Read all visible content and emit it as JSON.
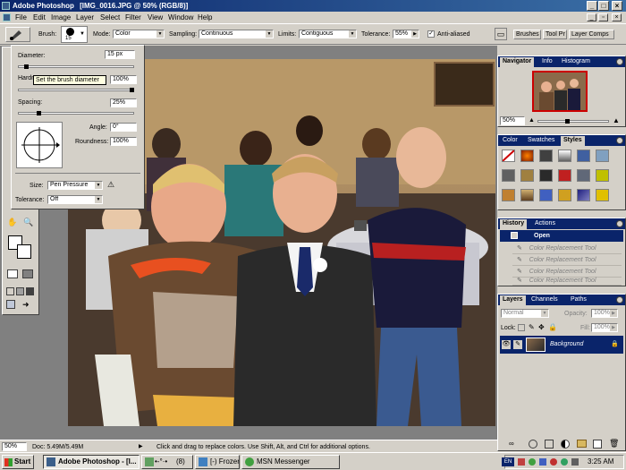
{
  "window": {
    "app_title": "Adobe Photoshop",
    "doc_title": "[IMG_0016.JPG @ 50% (RGB/8)]"
  },
  "menubar": [
    "File",
    "Edit",
    "Image",
    "Layer",
    "Select",
    "Filter",
    "View",
    "Window",
    "Help"
  ],
  "options": {
    "brush_label": "Brush:",
    "brush_size": "15",
    "mode_label": "Mode:",
    "mode_value": "Color",
    "sampling_label": "Sampling:",
    "sampling_value": "Continuous",
    "limits_label": "Limits:",
    "limits_value": "Contiguous",
    "tolerance_label": "Tolerance:",
    "tolerance_value": "55%",
    "antialiased_label": "Anti-aliased",
    "palette_tabs": [
      "Brushes",
      "Tool Pr",
      "Layer Comps"
    ]
  },
  "brush_popup": {
    "diameter_label": "Diameter:",
    "diameter_value": "15 px",
    "hardness_label": "Hardness:",
    "hardness_value": "100%",
    "spacing_label": "Spacing:",
    "spacing_value": "25%",
    "angle_label": "Angle:",
    "angle_value": "0°",
    "roundness_label": "Roundness:",
    "roundness_value": "100%",
    "size_label": "Size:",
    "size_value": "Pen Pressure",
    "tolerance_label": "Tolerance:",
    "tolerance_value": "Off",
    "tooltip": "Set the brush diameter"
  },
  "navigator": {
    "tabs": [
      "Navigator",
      "Info",
      "Histogram"
    ],
    "zoom": "50%"
  },
  "styles": {
    "tabs": [
      "Color",
      "Swatches",
      "Styles"
    ]
  },
  "history": {
    "tabs": [
      "History",
      "Actions"
    ],
    "items": [
      "Open",
      "Color Replacement Tool",
      "Color Replacement Tool",
      "Color Replacement Tool",
      "Color Replacement Tool"
    ]
  },
  "layers": {
    "tabs": [
      "Layers",
      "Channels",
      "Paths"
    ],
    "blend": "Normal",
    "opacity_label": "Opacity:",
    "opacity": "100%",
    "lock_label": "Lock:",
    "fill_label": "Fill:",
    "fill": "100%",
    "layer_name": "Background"
  },
  "status": {
    "zoom": "50%",
    "doc": "Doc: 5.49M/5.49M",
    "hint": "Click and drag to replace colors.  Use Shift, Alt, and Ctrl for additional options."
  },
  "taskbar": {
    "start": "Start",
    "buttons": [
      "Adobe Photoshop - [I...",
      "(8)",
      "[-) Frozen ...",
      "MSN Messenger"
    ],
    "lang": "EN",
    "clock": "3:25 AM"
  },
  "colors": {
    "title_blue": "#0a246a",
    "selection": "#0a246a",
    "chrome": "#d4d0c8"
  }
}
